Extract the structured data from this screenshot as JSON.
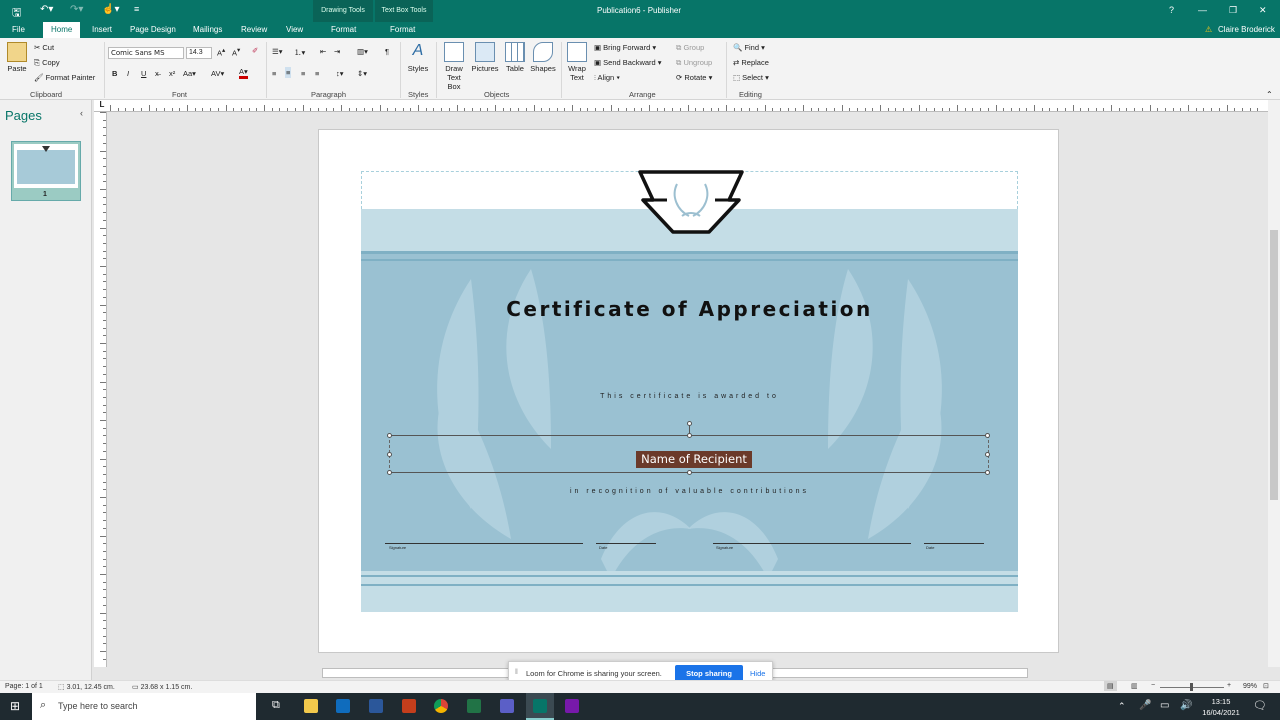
{
  "titlebar": {
    "title": "Publication6 - Publisher",
    "context_tab_1": "Drawing Tools",
    "context_tab_2": "Text Box Tools",
    "help": "?",
    "minimize": "—",
    "restore": "❐",
    "close": "✕"
  },
  "tabs": [
    "File",
    "Home",
    "Insert",
    "Page Design",
    "Mailings",
    "Review",
    "View",
    "Format",
    "Format"
  ],
  "user": {
    "name": "Claire Broderick",
    "warning_icon": "⚠"
  },
  "ribbon": {
    "clipboard": {
      "paste": "Paste",
      "cut": "Cut",
      "copy": "Copy",
      "format_painter": "Format Painter",
      "label": "Clipboard"
    },
    "font": {
      "family": "Comic Sans MS",
      "size": "14.3",
      "label": "Font"
    },
    "paragraph": {
      "label": "Paragraph"
    },
    "styles": {
      "styles": "Styles",
      "label": "Styles"
    },
    "objects": {
      "draw_text_box_1": "Draw",
      "draw_text_box_2": "Text Box",
      "pictures": "Pictures",
      "table": "Table",
      "shapes": "Shapes",
      "label": "Objects"
    },
    "arrange": {
      "wrap_1": "Wrap",
      "wrap_2": "Text",
      "bring_forward": "Bring Forward",
      "send_backward": "Send Backward",
      "align": "Align",
      "group": "Group",
      "ungroup": "Ungroup",
      "rotate": "Rotate",
      "label": "Arrange"
    },
    "editing": {
      "find": "Find",
      "replace": "Replace",
      "select": "Select",
      "label": "Editing"
    }
  },
  "pages_pane": {
    "title": "Pages",
    "page_number": "1"
  },
  "certificate": {
    "title": "Certificate of Appreciation",
    "awarded_to": "This certificate is awarded to",
    "recipient": "Name of Recipient",
    "recognition": "in recognition of valuable contributions",
    "sig1": "Signature",
    "date1": "Date",
    "sig2": "Signature",
    "date2": "Date"
  },
  "status": {
    "page": "Page: 1 of 1",
    "position": "3.01, 12.45 cm.",
    "size": "23.68 x 1.15 cm.",
    "zoom": "99%"
  },
  "share_banner": {
    "message": "Loom for Chrome is sharing your screen.",
    "stop": "Stop sharing",
    "hide": "Hide"
  },
  "taskbar": {
    "search_placeholder": "Type here to search",
    "time": "13:15",
    "date": "16/04/2021"
  },
  "colors": {
    "brand": "#077568",
    "cert_blue": "#9ac1d2",
    "selection_bg": "#6b3a2a"
  }
}
